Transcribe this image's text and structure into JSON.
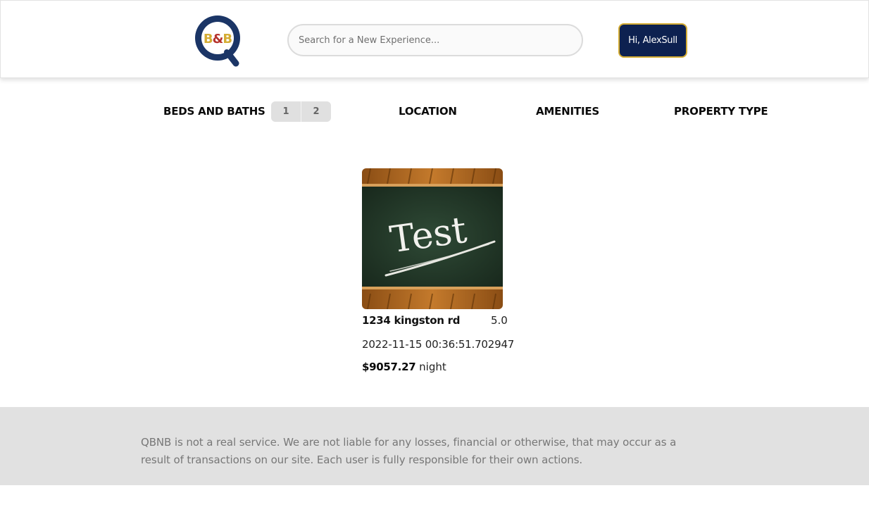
{
  "header": {
    "logo_text": "B&B",
    "logo_letter": "Q",
    "search_placeholder": "Search for a New Experience...",
    "user_button": "Hi, AlexSull"
  },
  "filters": {
    "beds_and_baths": "BEDS AND BATHS",
    "beds_options": [
      "1",
      "2"
    ],
    "location": "LOCATION",
    "amenities": "AMENITIES",
    "property_type": "PROPERTY TYPE"
  },
  "listings": [
    {
      "image_text": "Test",
      "title": "1234 kingston rd",
      "rating": "5.0",
      "date": "2022-11-15 00:36:51.702947",
      "price": "$9057.27",
      "price_unit": "night"
    }
  ],
  "footer": {
    "disclaimer": "QBNB is not a real service. We are not liable for any losses, financial or otherwise, that may occur as a result of transactions on our site. Each user is fully responsible for their own actions."
  },
  "colors": {
    "brand_navy": "#0d2150",
    "brand_gold": "#d4ac33",
    "brand_red": "#b5322c",
    "footer_bg": "#e1e1e1"
  }
}
